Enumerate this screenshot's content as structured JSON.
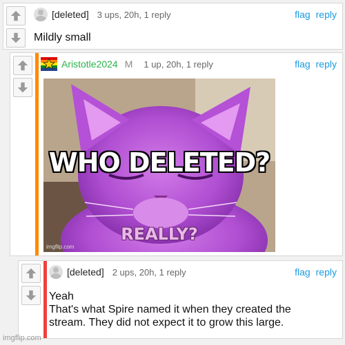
{
  "comments": [
    {
      "user": "[deleted]",
      "meta": "3 ups, 20h, 1 reply",
      "flag": "flag",
      "reply": "reply",
      "text": "Mildly small"
    },
    {
      "user": "Aristotle2024",
      "badge": "M",
      "meta": "1 up, 20h, 1 reply",
      "flag": "flag",
      "reply": "reply",
      "meme": {
        "top": "WHO DELETED?",
        "bottom": "REALLY?",
        "watermark": "imgflip.com"
      }
    },
    {
      "user": "[deleted]",
      "meta": "2 ups, 20h, 1 reply",
      "flag": "flag",
      "reply": "reply",
      "text_lines": [
        "Yeah",
        "That's what Spire named it when they created the",
        "stream. They did not expect it to grow this large."
      ]
    }
  ],
  "page_watermark": "imgflip.com",
  "colors": {
    "link": "#1a9ae0",
    "bar_orange": "#ff8a00",
    "bar_red": "#f04040",
    "username_green": "#2bb34b"
  },
  "icons": [
    "upvote-arrow-icon",
    "downvote-arrow-icon",
    "avatar-icon",
    "rainbow-star-flag-icon"
  ]
}
